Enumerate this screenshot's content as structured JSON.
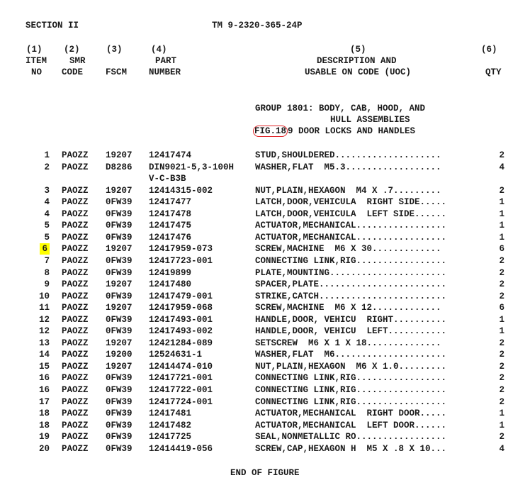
{
  "header": {
    "section": "SECTION II",
    "manual_number": "TM 9-2320-365-24P"
  },
  "columns": {
    "item": {
      "num": "(1)",
      "line1": "ITEM",
      "line2": "NO"
    },
    "smr": {
      "num": "(2)",
      "line1": "SMR",
      "line2": "CODE"
    },
    "fscm": {
      "num": "(3)",
      "line1": "",
      "line2": "FSCM"
    },
    "part": {
      "num": "(4)",
      "line1": "PART",
      "line2": "NUMBER"
    },
    "desc": {
      "num": "(5)",
      "line1": "DESCRIPTION AND",
      "line2": "USABLE ON CODE (UOC)"
    },
    "qty": {
      "num": "(6)",
      "line1": "",
      "line2": "QTY"
    }
  },
  "group": {
    "line1": "GROUP 1801: BODY, CAB, HOOD, AND",
    "line2": "HULL ASSEMBLIES",
    "fig_label": "FIG.18",
    "fig_rest": "9 DOOR LOCKS AND HANDLES",
    "annotation_color": "#e0262a"
  },
  "highlight_color": "#ffff00",
  "items": [
    {
      "item": "1",
      "smr": "PAOZZ",
      "fscm": "19207",
      "part": "12417474",
      "desc": "STUD,SHOULDERED....................",
      "qty": "2"
    },
    {
      "item": "2",
      "smr": "PAOZZ",
      "fscm": "D8286",
      "part": "DIN9021-5,3-100H",
      "part2": "V-C-B3B",
      "desc": "WASHER,FLAT  M5.3..................",
      "qty": "4"
    },
    {
      "item": "3",
      "smr": "PAOZZ",
      "fscm": "19207",
      "part": "12414315-002",
      "desc": "NUT,PLAIN,HEXAGON  M4 X .7.........",
      "qty": "2"
    },
    {
      "item": "4",
      "smr": "PAOZZ",
      "fscm": "0FW39",
      "part": "12417477",
      "desc": "LATCH,DOOR,VEHICULA  RIGHT SIDE.....",
      "qty": "1"
    },
    {
      "item": "4",
      "smr": "PAOZZ",
      "fscm": "0FW39",
      "part": "12417478",
      "desc": "LATCH,DOOR,VEHICULA  LEFT SIDE......",
      "qty": "1"
    },
    {
      "item": "5",
      "smr": "PAOZZ",
      "fscm": "0FW39",
      "part": "12417475",
      "desc": "ACTUATOR,MECHANICAL.................",
      "qty": "1"
    },
    {
      "item": "5",
      "smr": "PAOZZ",
      "fscm": "0FW39",
      "part": "12417476",
      "desc": "ACTUATOR,MECHANICAL.................",
      "qty": "1"
    },
    {
      "item": "6",
      "smr": "PAOZZ",
      "fscm": "19207",
      "part": "12417959-073",
      "desc": "SCREW,MACHINE  M6 X 30.............",
      "qty": "6",
      "highlight": true
    },
    {
      "item": "7",
      "smr": "PAOZZ",
      "fscm": "0FW39",
      "part": "12417723-001",
      "desc": "CONNECTING LINK,RIG.................",
      "qty": "2"
    },
    {
      "item": "8",
      "smr": "PAOZZ",
      "fscm": "0FW39",
      "part": "12419899",
      "desc": "PLATE,MOUNTING......................",
      "qty": "2"
    },
    {
      "item": "9",
      "smr": "PAOZZ",
      "fscm": "19207",
      "part": "12417480",
      "desc": "SPACER,PLATE........................",
      "qty": "2"
    },
    {
      "item": "10",
      "smr": "PAOZZ",
      "fscm": "0FW39",
      "part": "12417479-001",
      "desc": "STRIKE,CATCH........................",
      "qty": "2"
    },
    {
      "item": "11",
      "smr": "PAOZZ",
      "fscm": "19207",
      "part": "12417959-068",
      "desc": "SCREW,MACHINE  M6 X 12.............",
      "qty": "6"
    },
    {
      "item": "12",
      "smr": "PAOZZ",
      "fscm": "0FW39",
      "part": "12417493-001",
      "desc": "HANDLE,DOOR, VEHICU  RIGHT..........",
      "qty": "1"
    },
    {
      "item": "12",
      "smr": "PAOZZ",
      "fscm": "0FW39",
      "part": "12417493-002",
      "desc": "HANDLE,DOOR, VEHICU  LEFT...........",
      "qty": "1"
    },
    {
      "item": "13",
      "smr": "PAOZZ",
      "fscm": "19207",
      "part": "12421284-089",
      "desc": "SETSCREW  M6 X 1 X 18..............",
      "qty": "2"
    },
    {
      "item": "14",
      "smr": "PAOZZ",
      "fscm": "19200",
      "part": "12524631-1",
      "desc": "WASHER,FLAT  M6.....................",
      "qty": "2"
    },
    {
      "item": "15",
      "smr": "PAOZZ",
      "fscm": "19207",
      "part": "12414474-010",
      "desc": "NUT,PLAIN,HEXAGON  M6 X 1.0.........",
      "qty": "2"
    },
    {
      "item": "16",
      "smr": "PAOZZ",
      "fscm": "0FW39",
      "part": "12417721-001",
      "desc": "CONNECTING LINK,RIG.................",
      "qty": "2"
    },
    {
      "item": "16",
      "smr": "PAOZZ",
      "fscm": "0FW39",
      "part": "12417722-001",
      "desc": "CONNECTING LINK,RIG.................",
      "qty": "2"
    },
    {
      "item": "17",
      "smr": "PAOZZ",
      "fscm": "0FW39",
      "part": "12417724-001",
      "desc": "CONNECTING LINK,RIG.................",
      "qty": "2"
    },
    {
      "item": "18",
      "smr": "PAOZZ",
      "fscm": "0FW39",
      "part": "12417481",
      "desc": "ACTUATOR,MECHANICAL  RIGHT DOOR.....",
      "qty": "1"
    },
    {
      "item": "18",
      "smr": "PAOZZ",
      "fscm": "0FW39",
      "part": "12417482",
      "desc": "ACTUATOR,MECHANICAL  LEFT DOOR......",
      "qty": "1"
    },
    {
      "item": "19",
      "smr": "PAOZZ",
      "fscm": "0FW39",
      "part": "12417725",
      "desc": "SEAL,NONMETALLIC RO.................",
      "qty": "2"
    },
    {
      "item": "20",
      "smr": "PAOZZ",
      "fscm": "0FW39",
      "part": "12414419-056",
      "desc": "SCREW,CAP,HEXAGON H  M5 X .8 X 10...",
      "qty": "4"
    }
  ],
  "footer": "END OF FIGURE"
}
